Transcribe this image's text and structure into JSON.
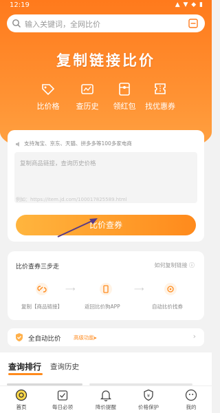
{
  "status": {
    "time": "12:19"
  },
  "search": {
    "placeholder": "输入关键词，全网比价"
  },
  "hero": {
    "title": "复制链接比价"
  },
  "features": [
    {
      "label": "比价格",
      "icon": "price-tag-icon"
    },
    {
      "label": "查历史",
      "icon": "history-icon"
    },
    {
      "label": "领红包",
      "icon": "red-packet-icon"
    },
    {
      "label": "找优惠券",
      "icon": "coupon-icon"
    }
  ],
  "input_card": {
    "support_text": "支持淘宝、京东、天猫、拼多多等100多家电商",
    "textarea_placeholder": "复制商品链接，查询历史价格",
    "example": "例如：https://item.jd.com/100017825589.html",
    "button_label": "比价查券"
  },
  "steps_card": {
    "title": "比价查券三步走",
    "help_link": "如何复制链接",
    "steps": [
      {
        "label": "复制【商品链接】",
        "icon": "link-icon"
      },
      {
        "label": "返回比价狗APP",
        "icon": "phone-icon"
      },
      {
        "label": "自动比价找券",
        "icon": "target-icon"
      }
    ]
  },
  "auto_card": {
    "label": "全自动比价",
    "advanced": "高级功能"
  },
  "tabs": [
    {
      "label": "查询排行",
      "active": true
    },
    {
      "label": "查询历史",
      "active": false
    }
  ],
  "nav": [
    {
      "label": "首页",
      "icon": "home-icon"
    },
    {
      "label": "每日必领",
      "icon": "daily-check-icon"
    },
    {
      "label": "降价提醒",
      "icon": "bell-icon"
    },
    {
      "label": "价格保护",
      "icon": "shield-icon"
    },
    {
      "label": "我的",
      "icon": "profile-icon"
    }
  ],
  "colors": {
    "accent": "#ff8a1c",
    "hero_top": "#ff7a1c",
    "hero_bottom": "#ffa545"
  }
}
